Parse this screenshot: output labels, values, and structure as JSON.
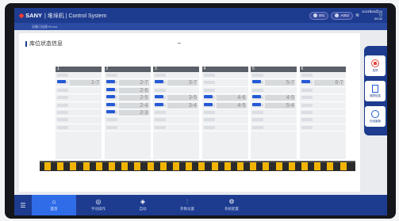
{
  "header": {
    "brand": "SANY",
    "title": "| 堆垛机 | Control System",
    "status_pills": [
      {
        "label": "001"
      },
      {
        "label": "A002"
      }
    ],
    "datetime_line1": "2023年08月24日",
    "datetime_line2": "09:32"
  },
  "subbar": {
    "text": "设备已连接 ID:xxx"
  },
  "panel": {
    "title": "库位状态信息",
    "columns": [
      {
        "label": "1",
        "positions": [
          "",
          "1-7",
          "",
          "",
          "",
          "",
          "",
          ""
        ]
      },
      {
        "label": "2",
        "positions": [
          "",
          "2-7",
          "2-6",
          "2-5",
          "2-4",
          "2-3",
          "",
          ""
        ]
      },
      {
        "label": "3",
        "positions": [
          "",
          "3-7",
          "",
          "3-5",
          "3-4",
          "",
          "",
          ""
        ]
      },
      {
        "label": "4",
        "positions": [
          "",
          "",
          "",
          "4-6",
          "4-5",
          "",
          "",
          ""
        ]
      },
      {
        "label": "5",
        "positions": [
          "",
          "5-7",
          "",
          "4-5",
          "5-4",
          "",
          "",
          ""
        ]
      },
      {
        "label": "6",
        "positions": [
          "",
          "6-7",
          "",
          "",
          "",
          "",
          "",
          ""
        ]
      }
    ]
  },
  "side": {
    "items": [
      {
        "label": "急停",
        "icon": "stop-icon"
      },
      {
        "label": "故障信息",
        "icon": "document-icon"
      },
      {
        "label": "在线客服",
        "icon": "chat-icon"
      }
    ]
  },
  "nav": {
    "menu_label": "菜单",
    "items": [
      {
        "label": "首页",
        "icon": "home-icon"
      },
      {
        "label": "手动操作",
        "icon": "manual-icon"
      },
      {
        "label": "自动",
        "icon": "layers-icon"
      },
      {
        "label": "参数设置",
        "icon": "sliders-icon"
      },
      {
        "label": "系统配置",
        "icon": "settings-icon"
      }
    ]
  }
}
